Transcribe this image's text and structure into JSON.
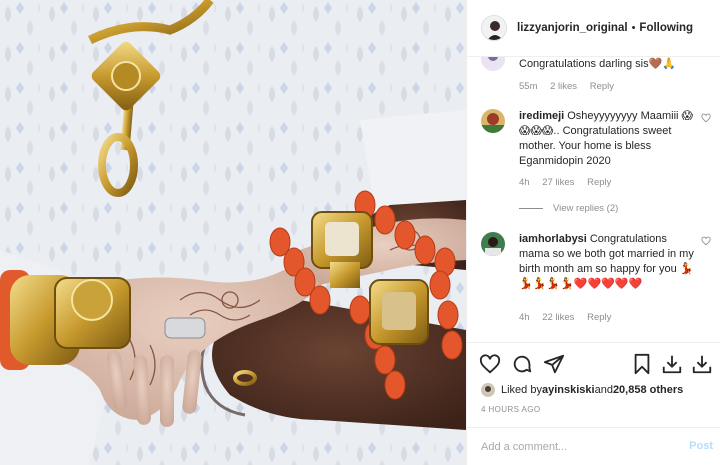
{
  "header": {
    "username": "lizzyanjorin_original",
    "separator": "•",
    "follow_state": "Following"
  },
  "comments": [
    {
      "user": "",
      "text": "Congratulations darling sis🤎🙏",
      "time": "55m",
      "likes": "2 likes",
      "reply": "Reply"
    },
    {
      "user": "iredimeji",
      "text": "Osheyyyyyyyy Maamiii 😱😱😱😱.. Congratulations sweet mother. Your home is bless Eganmidopin 2020",
      "time": "4h",
      "likes": "27 likes",
      "reply": "Reply",
      "view_replies": "View replies (2)"
    },
    {
      "user": "iamhorlabysi",
      "text": "Congratulations mama so we both got married in my birth month am so happy for you 💃💃💃💃💃❤️❤️❤️❤️❤️",
      "time": "4h",
      "likes": "22 likes",
      "reply": "Reply"
    }
  ],
  "likes": {
    "prefix": "Liked by ",
    "user": "ayinskiski",
    "joiner": " and ",
    "count": "20,858 others"
  },
  "timeago": "4 HOURS AGO",
  "add_comment": {
    "placeholder": "Add a comment...",
    "post_label": "Post"
  },
  "icons": [
    "heart-icon",
    "comment-icon",
    "share-icon",
    "bookmark-icon",
    "download-icon",
    "download-icon"
  ],
  "colors": {
    "link_blue": "#b2dffc",
    "muted": "#8e8e8e",
    "border": "#efefef"
  }
}
